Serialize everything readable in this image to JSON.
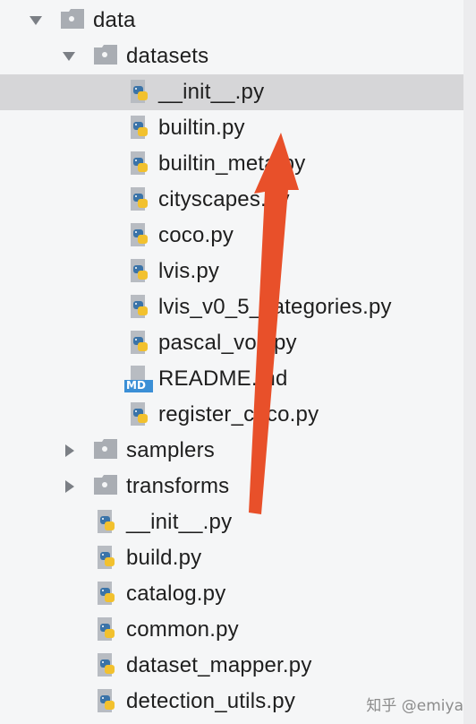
{
  "tree": {
    "root": {
      "label": "data",
      "expanded": true
    },
    "datasets": {
      "label": "datasets",
      "expanded": true,
      "files": [
        {
          "label": "__init__.py",
          "icon": "python-file-icon"
        },
        {
          "label": "builtin.py",
          "icon": "python-file-icon"
        },
        {
          "label": "builtin_meta.py",
          "icon": "python-file-icon"
        },
        {
          "label": "cityscapes.py",
          "icon": "python-file-icon"
        },
        {
          "label": "coco.py",
          "icon": "python-file-icon"
        },
        {
          "label": "lvis.py",
          "icon": "python-file-icon"
        },
        {
          "label": "lvis_v0_5_categories.py",
          "icon": "python-file-icon"
        },
        {
          "label": "pascal_voc.py",
          "icon": "python-file-icon"
        },
        {
          "label": "README.md",
          "icon": "markdown-file-icon",
          "badge": "MD"
        },
        {
          "label": "register_coco.py",
          "icon": "python-file-icon"
        }
      ]
    },
    "collapsed_folders": [
      {
        "label": "samplers",
        "expanded": false
      },
      {
        "label": "transforms",
        "expanded": false
      }
    ],
    "root_files": [
      {
        "label": "__init__.py",
        "icon": "python-file-icon"
      },
      {
        "label": "build.py",
        "icon": "python-file-icon"
      },
      {
        "label": "catalog.py",
        "icon": "python-file-icon"
      },
      {
        "label": "common.py",
        "icon": "python-file-icon"
      },
      {
        "label": "dataset_mapper.py",
        "icon": "python-file-icon"
      },
      {
        "label": "detection_utils.py",
        "icon": "python-file-icon"
      }
    ]
  },
  "selected": "datasets/__init__.py",
  "annotation": {
    "color": "#e8502a",
    "icon": "red-annotation-arrow"
  },
  "watermark": "知乎 @emiya",
  "colors": {
    "selection": "#d6d6d8",
    "folder": "#9aa0a6",
    "python_blue": "#3a73a8",
    "python_yellow": "#f2c12e",
    "md_badge": "#3b8fd6"
  }
}
